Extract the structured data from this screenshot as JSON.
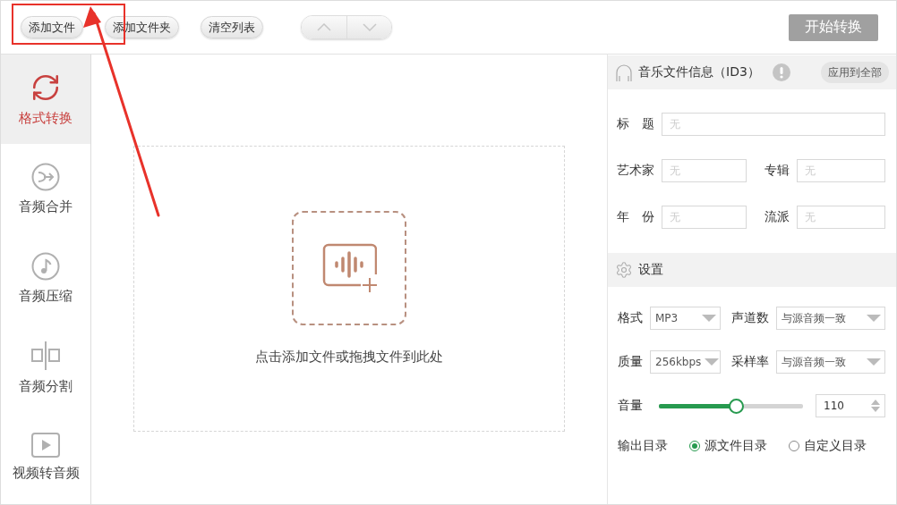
{
  "toolbar": {
    "buttons": [
      {
        "label": "添加文件"
      },
      {
        "label": "添加文件夹"
      },
      {
        "label": "清空列表"
      }
    ],
    "move_buttons": {
      "disabled": true
    },
    "start_button": {
      "label": "开始转换",
      "disabled": true
    }
  },
  "sidebar": {
    "items": [
      {
        "kind": "convert",
        "label": "格式转换",
        "selected": true
      },
      {
        "kind": "merge",
        "label": "音频合并",
        "selected": false
      },
      {
        "kind": "compress",
        "label": "音频压缩",
        "selected": false
      },
      {
        "kind": "split",
        "label": "音频分割",
        "selected": false
      },
      {
        "kind": "video",
        "label": "视频转音频",
        "selected": false
      }
    ]
  },
  "dropzone": {
    "hint": "点击添加文件或拖拽文件到此处"
  },
  "id3_panel": {
    "title": "音乐文件信息（ID3）",
    "apply_button": "应用到全部",
    "rows": [
      [
        {
          "label": "标　题",
          "placeholder": "无"
        }
      ],
      [
        {
          "label": "艺术家",
          "placeholder": "无"
        },
        {
          "label": "专辑",
          "placeholder": "无"
        }
      ],
      [
        {
          "label": "年　份",
          "placeholder": "无"
        },
        {
          "label": "流派",
          "placeholder": "无"
        }
      ]
    ]
  },
  "settings": {
    "title": "设置",
    "selects": [
      [
        {
          "label": "格式",
          "value": "MP3"
        },
        {
          "label": "声道数",
          "value": "与源音频一致"
        }
      ],
      [
        {
          "label": "质量",
          "value": "256kbps"
        },
        {
          "label": "采样率",
          "value": "与源音频一致"
        }
      ]
    ],
    "volume": {
      "label": "音量",
      "level": 0.535,
      "value": "110"
    },
    "output": {
      "label": "输出目录",
      "options": [
        {
          "label": "源文件目录",
          "selected": true
        },
        {
          "label": "自定义目录",
          "selected": false
        }
      ]
    }
  }
}
